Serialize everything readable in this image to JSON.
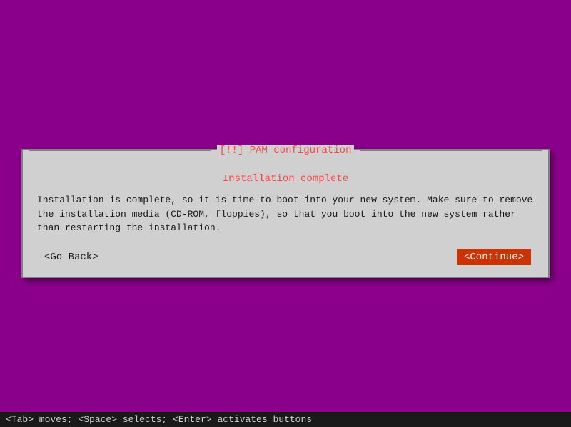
{
  "dialog": {
    "title": "[!!] PAM configuration",
    "subtitle": "Installation complete",
    "body_text": "Installation is complete, so it is time to boot into your new system. Make sure to remove the installation media (CD-ROM, floppies), so that you boot into the new system rather than restarting the installation.",
    "btn_back": "<Go Back>",
    "btn_continue": "<Continue>"
  },
  "status_bar": {
    "text": "<Tab> moves; <Space> selects; <Enter> activates buttons"
  }
}
